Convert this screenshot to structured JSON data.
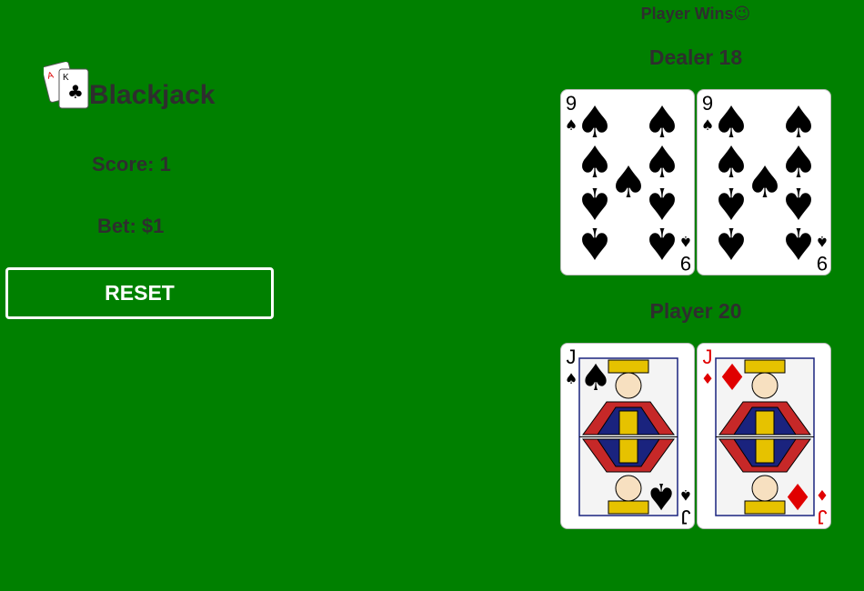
{
  "game": {
    "title": "Blackjack",
    "score_text": "Score: 1",
    "bet_text": "Bet: $1",
    "reset_label": "RESET",
    "result_text": "Player Wins😉"
  },
  "dealer": {
    "label": "Dealer 18",
    "cards": [
      {
        "rank": "9",
        "suit": "spades",
        "symbol": "♠",
        "color": "#000000"
      },
      {
        "rank": "9",
        "suit": "spades",
        "symbol": "♠",
        "color": "#000000"
      }
    ]
  },
  "player": {
    "label": "Player 20",
    "cards": [
      {
        "rank": "J",
        "suit": "spades",
        "symbol": "♠",
        "color": "#000000"
      },
      {
        "rank": "J",
        "suit": "diamonds",
        "symbol": "♦",
        "color": "#e00000"
      }
    ]
  },
  "colors": {
    "table": "#008000",
    "text": "#2e2e2e",
    "button_border": "#ffffff"
  },
  "icons": {
    "logo": "playing-cards-icon"
  }
}
